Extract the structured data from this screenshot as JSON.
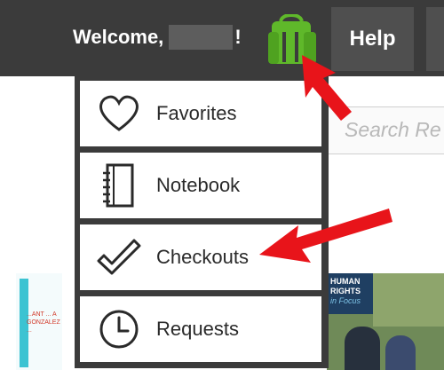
{
  "header": {
    "welcome_prefix": "Welcome,",
    "welcome_suffix": "!",
    "backpack_icon": "backpack-icon",
    "help_label": "Help"
  },
  "search": {
    "placeholder": "Search Re"
  },
  "dropdown": {
    "items": [
      {
        "label": "Favorites",
        "icon": "heart-icon"
      },
      {
        "label": "Notebook",
        "icon": "notebook-icon"
      },
      {
        "label": "Checkouts",
        "icon": "checkmark-icon"
      },
      {
        "label": "Requests",
        "icon": "clock-icon"
      }
    ]
  },
  "background_thumbnails": {
    "left_text": "...ANT ... A GONZALEZ ...",
    "right_title_line1": "HUMAN",
    "right_title_line2": "RIGHTS",
    "right_title_line3": "in Focus"
  },
  "colors": {
    "topbar": "#3b3b3b",
    "help_bg": "#4f4f4f",
    "backpack_green": "#5fb82a",
    "annotation_arrow": "#e8141a"
  }
}
